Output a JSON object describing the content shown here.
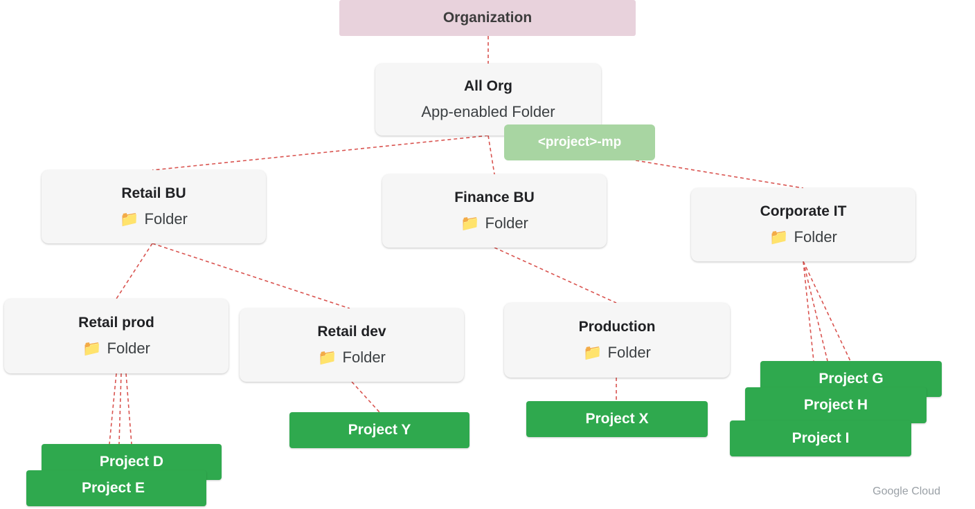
{
  "org_label": "Organization",
  "all_org": {
    "title": "All Org",
    "subtitle": "App-enabled Folder"
  },
  "mp_label": "<project>-mp",
  "folder_word": "Folder",
  "folders": {
    "retail_bu": "Retail BU",
    "finance_bu": "Finance BU",
    "corporate_it": "Corporate IT",
    "retail_prod": "Retail prod",
    "retail_dev": "Retail dev",
    "production": "Production"
  },
  "projects": {
    "d": "Project D",
    "e": "Project E",
    "y": "Project Y",
    "x": "Project X",
    "g": "Project G",
    "h": "Project H",
    "i": "Project I"
  },
  "brand": "Google Cloud",
  "colors": {
    "connector": "#d9534f",
    "project_green": "#2fa94e",
    "mp_green": "#a8d5a2",
    "org_pink": "#e8d2dc"
  }
}
